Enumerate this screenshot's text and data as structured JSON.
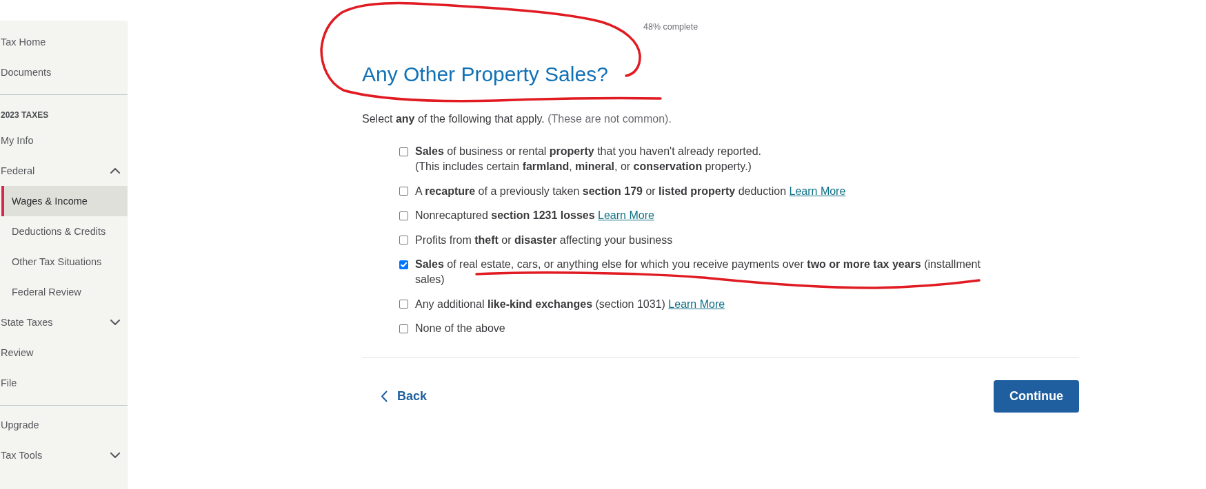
{
  "sidebar": {
    "items": [
      {
        "kind": "link",
        "label": "Tax Home",
        "selected": false
      },
      {
        "kind": "link",
        "label": "Documents",
        "selected": false
      },
      {
        "kind": "divider"
      },
      {
        "kind": "heading",
        "label": "2023 TAXES"
      },
      {
        "kind": "link",
        "label": "My Info",
        "selected": false
      },
      {
        "kind": "group",
        "label": "Federal",
        "selected": false,
        "expanded": true,
        "children": [
          {
            "label": "Wages & Income",
            "selected": true
          },
          {
            "label": "Deductions & Credits",
            "selected": false
          },
          {
            "label": "Other Tax Situations",
            "selected": false
          },
          {
            "label": "Federal Review",
            "selected": false
          }
        ]
      },
      {
        "kind": "group",
        "label": "State Taxes",
        "selected": false,
        "expanded": false
      },
      {
        "kind": "link",
        "label": "Review",
        "selected": false
      },
      {
        "kind": "link",
        "label": "File",
        "selected": false
      },
      {
        "kind": "divider"
      },
      {
        "kind": "link",
        "label": "Upgrade",
        "selected": false
      },
      {
        "kind": "group",
        "label": "Tax Tools",
        "selected": false,
        "expanded": false
      }
    ]
  },
  "progress": {
    "label": "48% complete"
  },
  "page": {
    "title": "Any Other Property Sales?",
    "title_circled": true,
    "intro": "Select **any** of the following that apply.",
    "intro_note": "(These are not common)."
  },
  "options": [
    {
      "text": "**Sales** of business or rental **property** that you haven't already reported.",
      "note": "(This includes certain **farmland**, **mineral**, or **conservation** property.)",
      "checked": false,
      "underlined": false
    },
    {
      "text": "A **recapture** of a previously taken **section 179** or **listed property** deduction",
      "link": "Learn More",
      "checked": false,
      "underlined": false
    },
    {
      "text": "Nonrecaptured **section 1231 losses**",
      "link": "Learn More",
      "checked": false,
      "underlined": false
    },
    {
      "text": "Profits from **theft** or **disaster** affecting your business",
      "checked": false,
      "underlined": false
    },
    {
      "text": "**Sales** of real estate, cars, or anything else for which you receive payments over **two or more tax years** (installment sales)",
      "checked": true,
      "underlined": true
    },
    {
      "text": "Any additional **like-kind exchanges** (section 1031)",
      "link": "Learn More",
      "checked": false,
      "underlined": false
    },
    {
      "text": "None of the above",
      "checked": false,
      "underlined": false
    }
  ],
  "actions": {
    "back": "Back",
    "continue": "Continue"
  }
}
